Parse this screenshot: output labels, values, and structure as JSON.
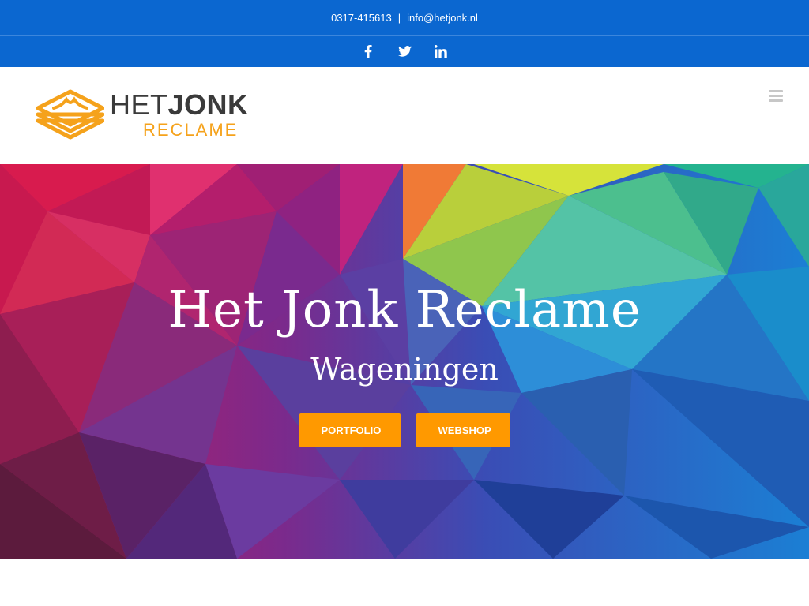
{
  "topbar": {
    "phone": "0317-415613",
    "separator": "|",
    "email": "info@hetjonk.nl"
  },
  "social": {
    "icons": [
      "facebook-icon",
      "twitter-icon",
      "linkedin-icon"
    ]
  },
  "logo": {
    "word_het": "HET",
    "word_jonk": "JONK",
    "word_reclame": "RECLAME"
  },
  "hero": {
    "title": "Het Jonk Reclame",
    "subtitle": "Wageningen",
    "buttons": {
      "portfolio": "PORTFOLIO",
      "webshop": "WEBSHOP"
    }
  },
  "colors": {
    "bar": "#0b67d0",
    "accent": "#ff9900",
    "logo_orange": "#f5a21b"
  }
}
